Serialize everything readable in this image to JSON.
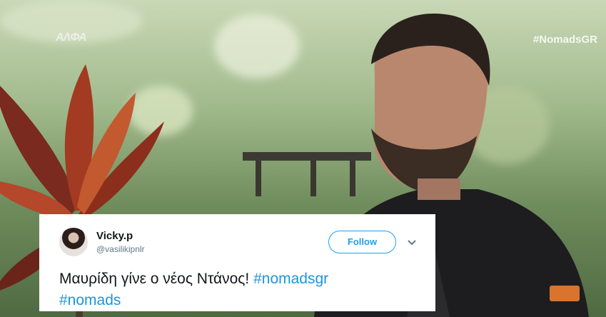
{
  "overlay": {
    "channel_logo": "ΑΛΦΑ",
    "hashtag_watermark": "#NomadsGR"
  },
  "tweet": {
    "user_name": "Vicky.p",
    "user_handle": "@vasilikipnlr",
    "follow_label": "Follow",
    "text_plain": "Μαυρίδη γίνε ο νέος Ντάνος!",
    "hashtag_1": "#nomadsgr",
    "hashtag_2": "#nomads"
  },
  "colors": {
    "link": "#1b95e0",
    "follow_accent": "#1da1f2"
  }
}
